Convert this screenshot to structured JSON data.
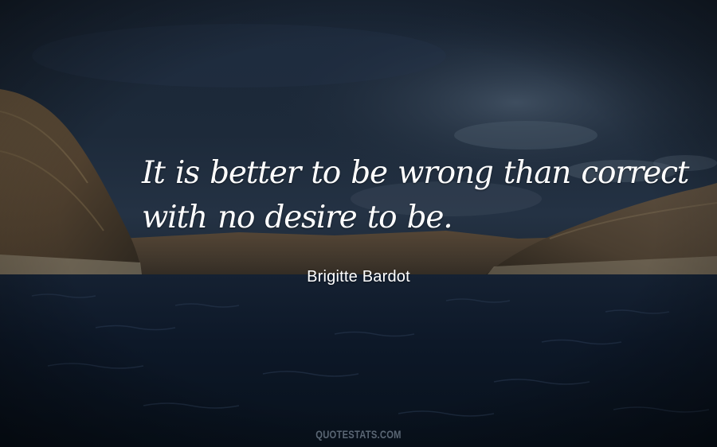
{
  "quote": {
    "lines": [
      "It is better to be wrong than correct",
      "with no desire to be."
    ],
    "author": "Brigitte Bardot"
  },
  "watermark": "QUOTESTATS.COM",
  "colors": {
    "sky_dark": "#16202e",
    "sky_cloud": "#2f3e50",
    "rock": "#5a4a36",
    "rock_highlight": "#7a6548",
    "water": "#0c1624",
    "text": "#ffffff",
    "watermark": "#5a6674"
  }
}
